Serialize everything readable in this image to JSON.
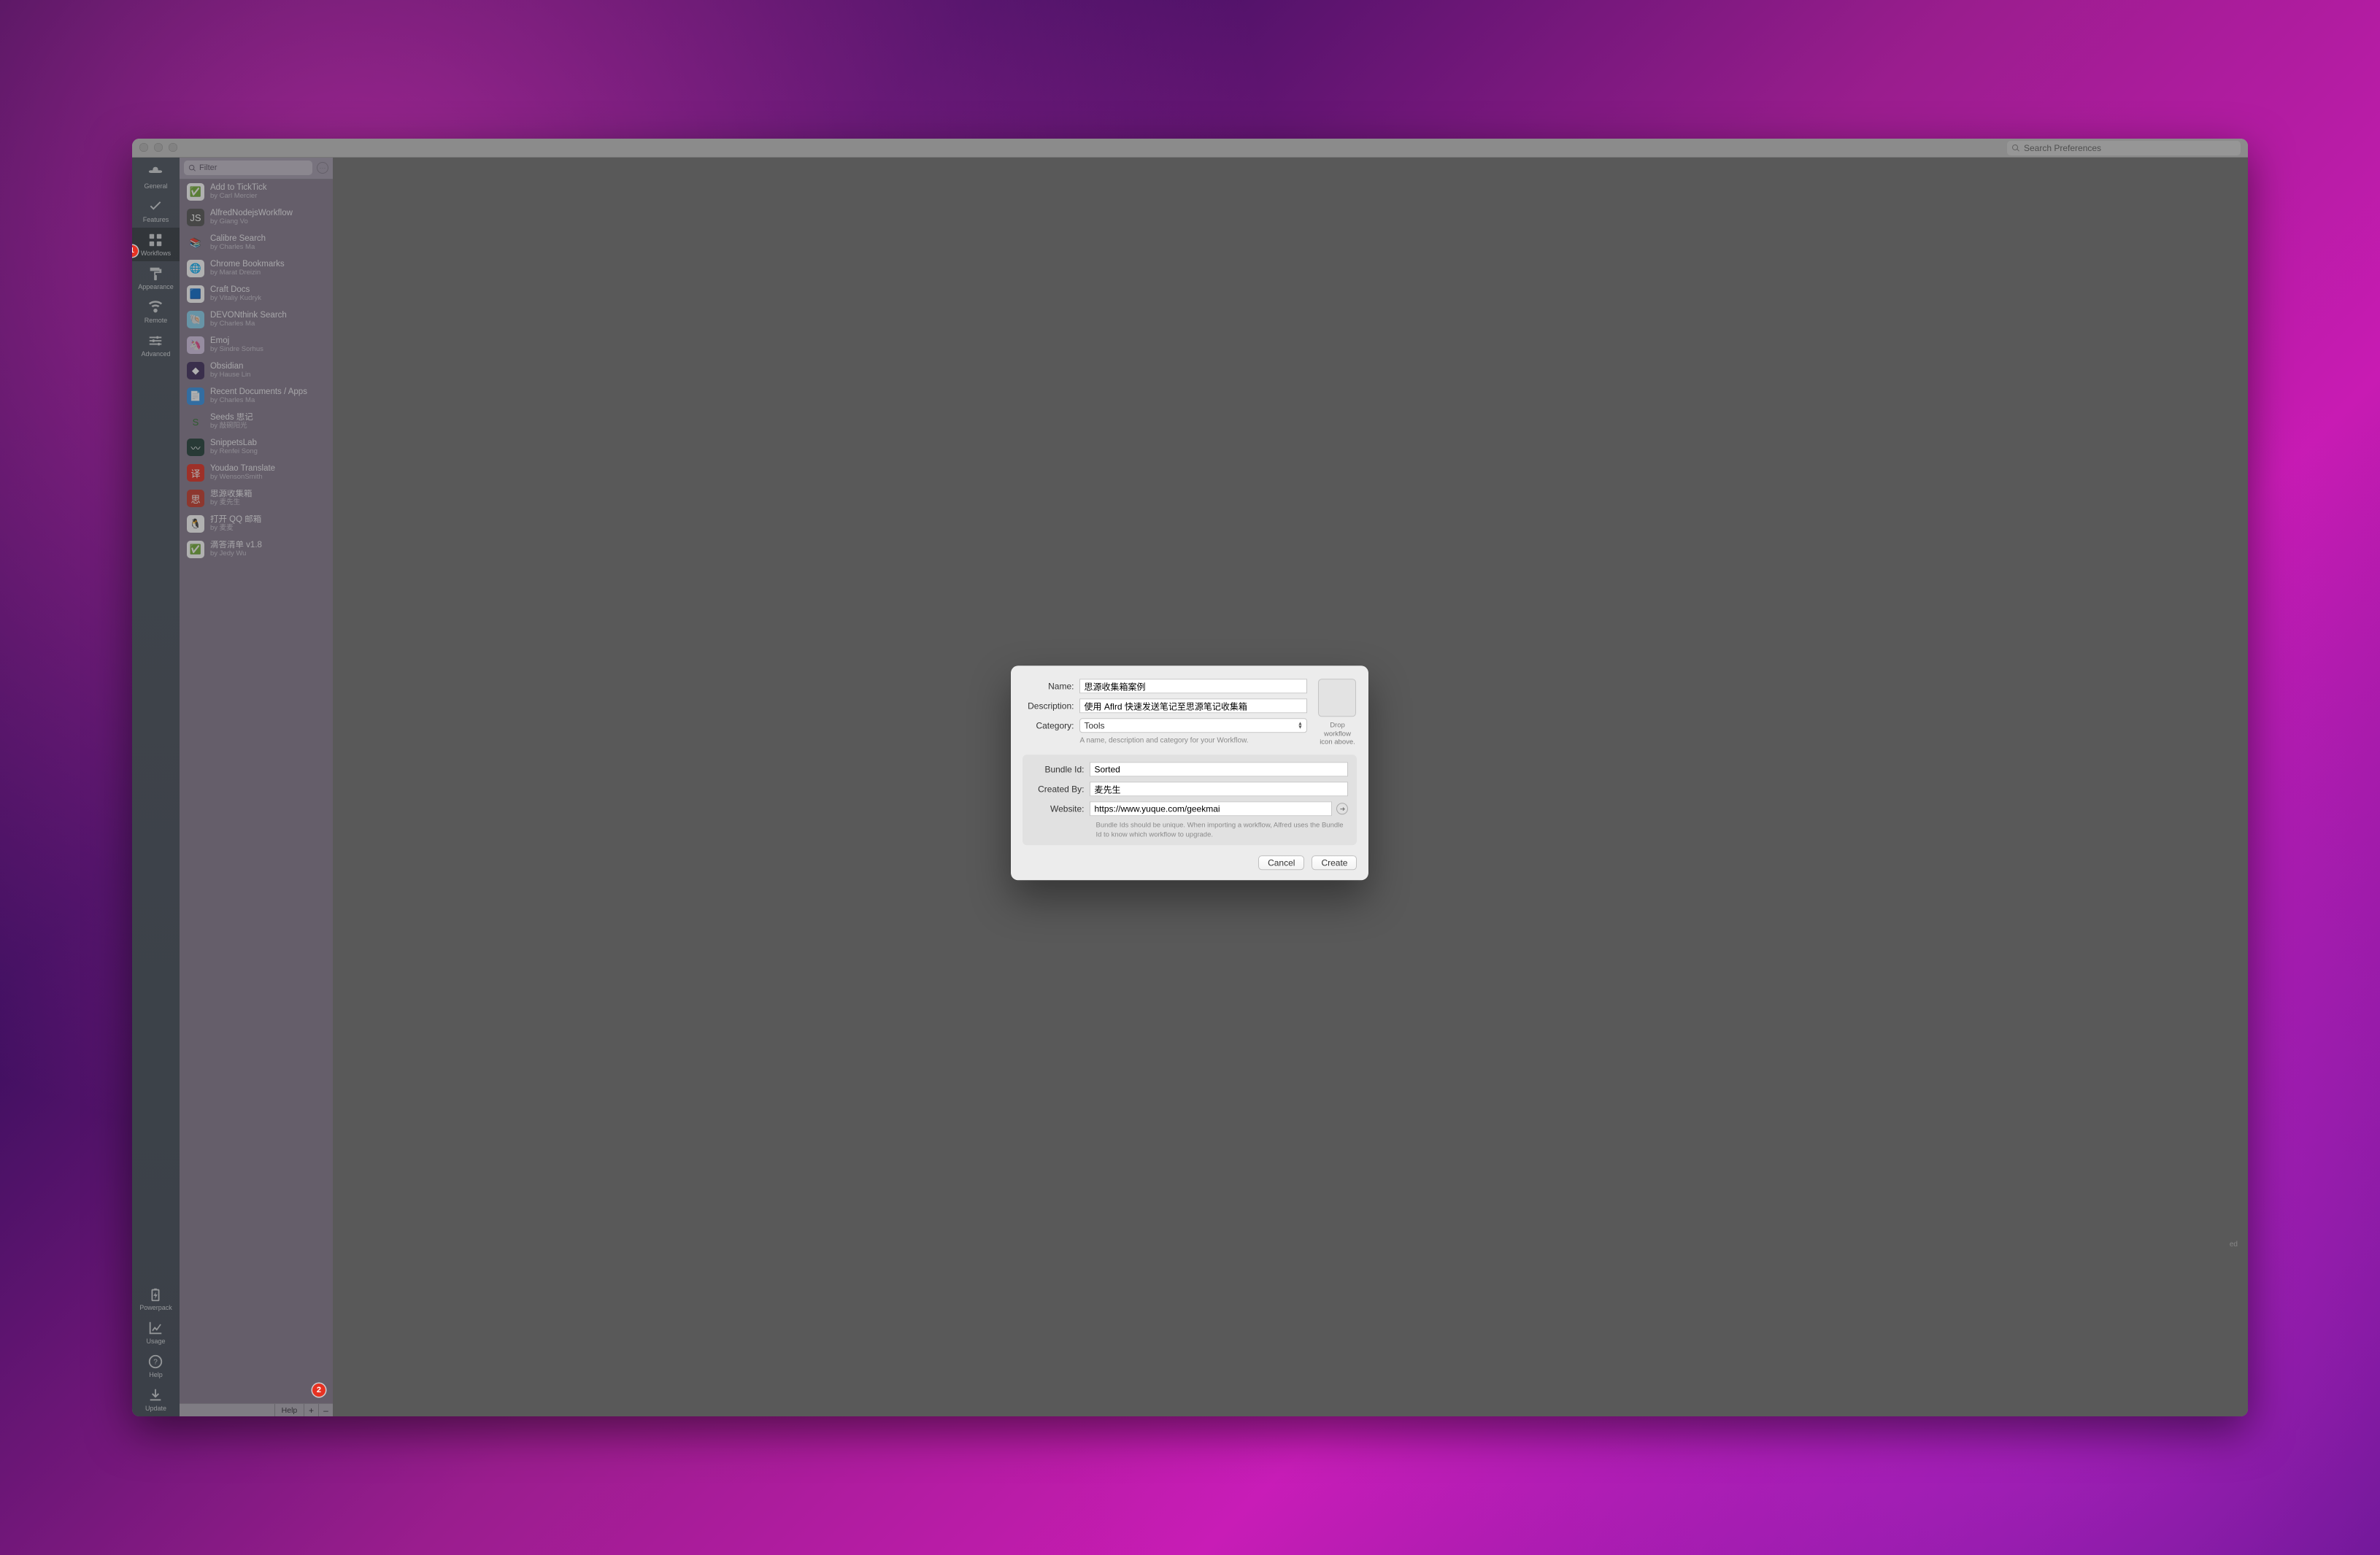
{
  "search_placeholder": "Search Preferences",
  "nav": [
    {
      "key": "general",
      "label": "General"
    },
    {
      "key": "features",
      "label": "Features"
    },
    {
      "key": "workflows",
      "label": "Workflows"
    },
    {
      "key": "appearance",
      "label": "Appearance"
    },
    {
      "key": "remote",
      "label": "Remote"
    },
    {
      "key": "advanced",
      "label": "Advanced"
    }
  ],
  "nav_bottom": [
    {
      "key": "powerpack",
      "label": "Powerpack"
    },
    {
      "key": "usage",
      "label": "Usage"
    },
    {
      "key": "help",
      "label": "Help"
    },
    {
      "key": "update",
      "label": "Update"
    }
  ],
  "nav_selected": "workflows",
  "filter_placeholder": "Filter",
  "workflows": [
    {
      "name": "Add to TickTick",
      "author": "by Carl Mercier",
      "bg": "#ffffff",
      "emoji": "✅"
    },
    {
      "name": "AlfredNodejsWorkflow",
      "author": "by Giang Vo",
      "bg": "#5e5e5e",
      "emoji": "JS"
    },
    {
      "name": "Calibre Search",
      "author": "by Charles Ma",
      "bg": "transparent",
      "emoji": "📚"
    },
    {
      "name": "Chrome Bookmarks",
      "author": "by Marat Dreizin",
      "bg": "#ffffff",
      "emoji": "🌐"
    },
    {
      "name": "Craft Docs",
      "author": "by Vitaliy Kudryk",
      "bg": "#ffffff",
      "emoji": "🟦"
    },
    {
      "name": "DEVONthink Search",
      "author": "by Charles Ma",
      "bg": "#8fd4f0",
      "emoji": "🐚"
    },
    {
      "name": "Emoj",
      "author": "by Sindre Sorhus",
      "bg": "#d8c8e6",
      "emoji": "🦄"
    },
    {
      "name": "Obsidian",
      "author": "by Hause Lin",
      "bg": "#4b3a66",
      "emoji": "◆"
    },
    {
      "name": "Recent Documents / Apps",
      "author": "by Charles Ma",
      "bg": "#3f99e8",
      "emoji": "📄"
    },
    {
      "name": "Seeds 思记",
      "author": "by 敲碗阳光",
      "bg": "transparent",
      "emoji": "S"
    },
    {
      "name": "SnippetsLab",
      "author": "by Renfei Song",
      "bg": "#2e4a44",
      "emoji": "〰"
    },
    {
      "name": "Youdao Translate",
      "author": "by WensonSmith",
      "bg": "#e33b2e",
      "emoji": "译"
    },
    {
      "name": "思源收集箱",
      "author": "by 麦先生",
      "bg": "#c94638",
      "emoji": "思"
    },
    {
      "name": "打开 QQ 邮箱",
      "author": "by 麦麦",
      "bg": "#ffffff",
      "emoji": "🐧"
    },
    {
      "name": "滴答清单 v1.8",
      "author": "by Jedy Wu",
      "bg": "#ffffff",
      "emoji": "✅"
    }
  ],
  "annotations": {
    "badge1": "1",
    "badge2": "2"
  },
  "footer": {
    "help": "Help",
    "plus": "+",
    "minus": "–"
  },
  "modal": {
    "labels": {
      "name": "Name:",
      "description": "Description:",
      "category": "Category:",
      "bundle": "Bundle Id:",
      "created": "Created By:",
      "website": "Website:"
    },
    "values": {
      "name": "思源收集箱案例",
      "description": "使用 Aflrd 快速发送笔记至思源笔记收集箱",
      "category": "Tools",
      "bundle": "Sorted",
      "created": "麦先生",
      "website": "https://www.yuque.com/geekmai"
    },
    "helper": "A name, description and category for your Workflow.",
    "sub_helper": "Bundle Ids should be unique. When importing a workflow, Alfred uses the Bundle Id to know which workflow to upgrade.",
    "icon_drop": "Drop workflow icon above.",
    "cancel": "Cancel",
    "create": "Create"
  },
  "canvas_hint": "ed"
}
